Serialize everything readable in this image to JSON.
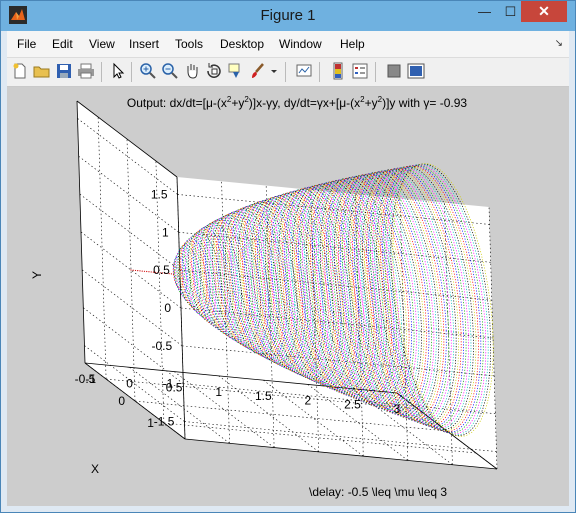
{
  "window": {
    "title": "Figure 1",
    "close_glyph": "✕",
    "minimize_glyph": "—",
    "maximize_glyph": "☐"
  },
  "menu": [
    "File",
    "Edit",
    "View",
    "Insert",
    "Tools",
    "Desktop",
    "Window",
    "Help"
  ],
  "menu_dock_glyph": "↘",
  "toolbar_icons": [
    "new-figure-icon",
    "open-file-icon",
    "save-icon",
    "print-icon",
    "edit-plot-arrow-icon",
    "zoom-in-icon",
    "zoom-out-icon",
    "pan-hand-icon",
    "rotate-3d-icon",
    "data-cursor-icon",
    "brush-icon",
    "brush-dropdown-icon",
    "link-plot-icon",
    "insert-colorbar-icon",
    "insert-legend-icon",
    "hide-plot-tools-icon",
    "show-plot-tools-icon"
  ],
  "plot": {
    "title": "Output: dx/dt=[μ-(x²+y²)]x-γy, dy/dt=γx+[μ-(x²+y²)]y with γ= -0.93",
    "title_parts": {
      "a": "Output: dx/dt=[μ-(x",
      "sup1": "2",
      "b": "+y",
      "sup2": "2",
      "c": ")]x-γy, dy/dt=γx+[μ-(x",
      "sup3": "2",
      "d": "+y",
      "sup4": "2",
      "e": ")]y with γ= -0.93"
    },
    "xlabel": "\\delay: -0.5 \\leq \\mu \\leq 3",
    "ylabel": "Y",
    "zlabel": "X"
  },
  "chart_data": {
    "type": "line",
    "title": "Output: dx/dt=[μ-(x²+y²)]x-γy, dy/dt=γx+[μ-(x²+y²)]y with γ= -0.93",
    "xlabel": "\\delay: -0.5 \\leq \\mu \\leq 3",
    "ylabel": "Y",
    "zlabel": "X",
    "mu_range": [
      -0.5,
      3
    ],
    "ylim": [
      -1.73,
      1.73
    ],
    "xlim": [
      -1.73,
      1.73
    ],
    "mu_ticks": [
      "-0.5",
      "0",
      "0.5",
      "1",
      "1.5",
      "2",
      "2.5",
      "3"
    ],
    "y_ticks": [
      "-1.5",
      "-1",
      "-0.5",
      "0",
      "0.5",
      "1",
      "1.5"
    ],
    "x_ticks": [
      "-1",
      "0",
      "1"
    ],
    "radius_formula": "r = sqrt(mu) for mu > 0, 0 otherwise",
    "grid": true,
    "line_style": "dotted",
    "series_colors": [
      "#ff0000",
      "#0000ff",
      "#00a000",
      "#ff00ff",
      "#00c0c0",
      "#000000",
      "#cccc00"
    ]
  }
}
